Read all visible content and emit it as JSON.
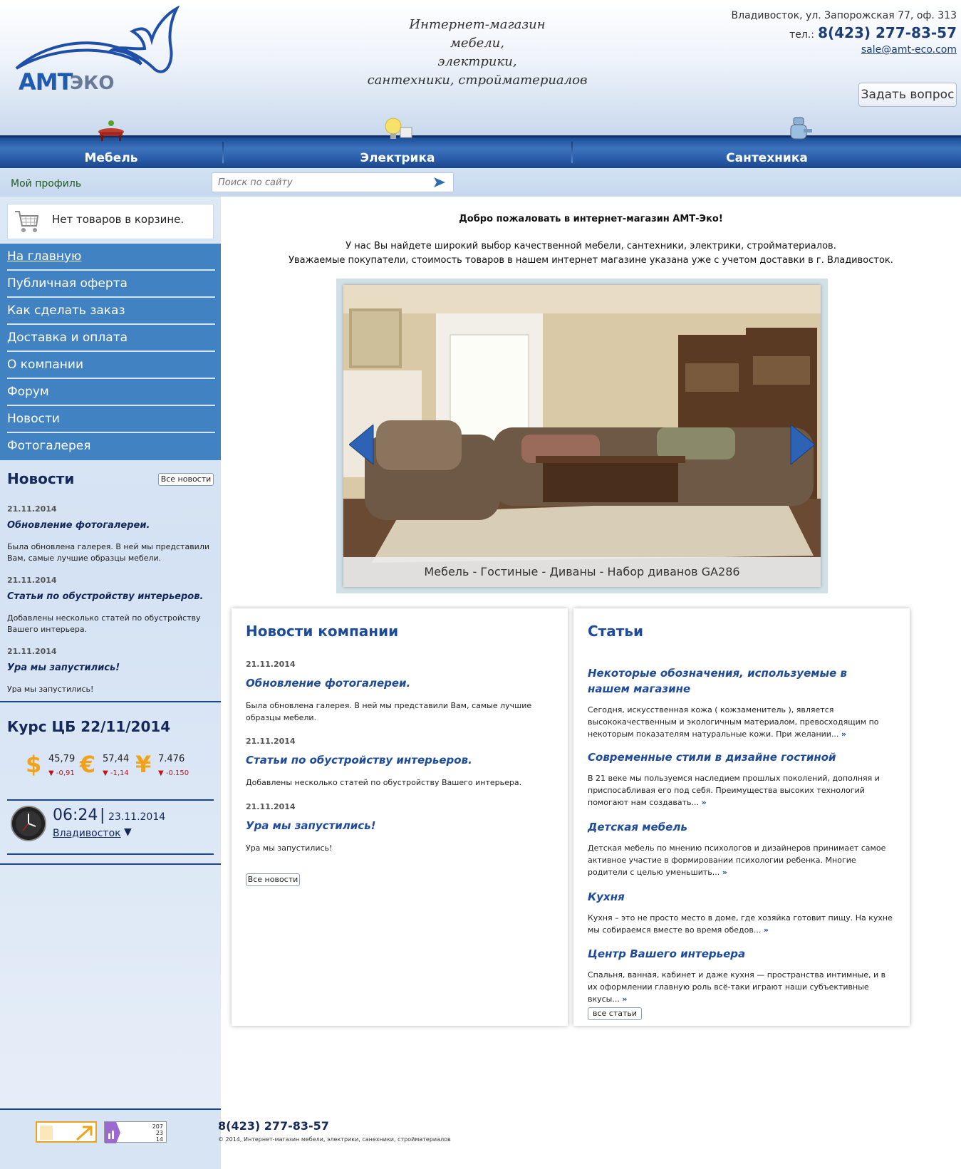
{
  "header": {
    "logo_amt": "АМТ",
    "logo_eko": "ЭКО",
    "slogan": [
      "Интернет-магазин",
      "мебели,",
      "электрики,",
      "сантехники, стройматериалов"
    ],
    "address": "Владивосток, ул. Запорожская 77, оф. 313",
    "phone_prefix": "тел.:",
    "phone": "8(423) 277-83-57",
    "email": "sale@amt-eco.com",
    "ask_button": "Задать вопрос"
  },
  "nav": {
    "items": [
      {
        "label": "Мебель",
        "icon": "table-icon"
      },
      {
        "label": "Электрика",
        "icon": "lightbulb-icon"
      },
      {
        "label": "Сантехника",
        "icon": "faucet-icon"
      }
    ]
  },
  "subbar": {
    "profile": "Мой профиль",
    "search_placeholder": "Поиск по сайту"
  },
  "sidebar": {
    "cart": "Нет товаров в корзине.",
    "menu": [
      "На главную",
      "Публичная оферта",
      "Как сделать заказ",
      "Доставка и оплата",
      "О компании",
      "Форум",
      "Новости",
      "Фотогалерея"
    ],
    "news_title": "Новости",
    "all_news": "Все новости",
    "news": [
      {
        "date": "21.11.2014",
        "title": "Обновление фотогалереи.",
        "text": "Была обновлена галерея. В ней мы представили Вам, самые лучшие образцы мебели."
      },
      {
        "date": "21.11.2014",
        "title": "Статьи по обустройству интерьеров.",
        "text": "Добавлены несколько статей по обустройству Вашего интерьера."
      },
      {
        "date": "21.11.2014",
        "title": "Ура мы запустились!",
        "text": "Ура мы запустились!"
      }
    ],
    "rates_title": "Курс ЦБ 22/11/2014",
    "rates": [
      {
        "symbol": "$",
        "value": "45,79",
        "delta": "-0,91"
      },
      {
        "symbol": "€",
        "value": "57,44",
        "delta": "-1,14"
      },
      {
        "symbol": "¥",
        "value": "7.476",
        "delta": "-0.150"
      }
    ],
    "clock": {
      "time": "06:24",
      "sep": "|",
      "date": "23.11.2014",
      "city": "Владивосток",
      "arrow": "▼"
    }
  },
  "main": {
    "welcome": "Добро пожаловать в интернет-магазин АМТ-Эко!",
    "intro1": "У нас Вы найдете широкий выбор качественной мебели, сантехники, электрики, стройматериалов.",
    "intro2": "Уважаемые покупатели, стоимость товаров в нашем интернет магазине указана уже с учетом доставки в г. Владивосток.",
    "slide_caption": "Мебель - Гостиные - Диваны - Набор диванов GA286"
  },
  "company_news": {
    "title": "Новости компании",
    "items": [
      {
        "date": "21.11.2014",
        "title": "Обновление фотогалереи.",
        "text": "Была обновлена галерея. В ней мы представили Вам, самые лучшие образцы мебели."
      },
      {
        "date": "21.11.2014",
        "title": "Статьи по обустройству интерьеров.",
        "text": "Добавлены несколько статей по обустройству Вашего интерьера."
      },
      {
        "date": "21.11.2014",
        "title": "Ура мы запустились!",
        "text": "Ура мы запустились!"
      }
    ],
    "button": "Все новости"
  },
  "articles": {
    "title": "Статьи",
    "items": [
      {
        "title": "Некоторые обозначения, используемые в нашем магазине",
        "text": "  Сегодня, искусственная кожа ( кожзаменитель ), является высококачественным и экологичным материалом, превосходящим по некоторым показателям натуральные кожи. При желании..."
      },
      {
        "title": "Современные стили в дизайне гостиной",
        "text": "В 21 веке мы пользуемся наследием прошлых поколений, дополняя и приспосабливая его под себя. Преимущества высоких технологий помогают нам создавать..."
      },
      {
        "title": "Детская мебель",
        "text": "  Детская мебель по мнению психологов и дизайнеров принимает самое активное участие в формировании психологии ребенка. Многие родители с целью уменьшить..."
      },
      {
        "title": "Кухня",
        "text": "Кухня – это не просто место в доме, где хозяйка готовит пищу. На кухне мы собираемся вместе во время обедов..."
      },
      {
        "title": "Центр Вашего интерьера",
        "text": "Спальня, ванная, кабинет и даже кухня — пространства интимные, и в их оформлении главную роль всё-таки играют наши субъективные вкусы..."
      }
    ],
    "more": "»",
    "button": "все статьи"
  },
  "footer": {
    "phone": "8(423) 277-83-57",
    "copyright": "© 2014, Интернет-магазин мебели, электрики, санехники, стройматериалов",
    "counter2": [
      "207",
      "23",
      "14"
    ]
  }
}
